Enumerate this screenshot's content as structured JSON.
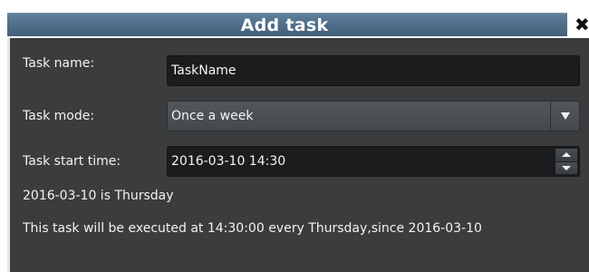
{
  "dialog": {
    "title": "Add task",
    "close_label": "✖"
  },
  "form": {
    "task_name": {
      "label": "Task name:",
      "value": "TaskName"
    },
    "task_mode": {
      "label": "Task mode:",
      "selected": "Once a week"
    },
    "task_start_time": {
      "label": "Task start time:",
      "value": "2016-03-10 14:30"
    }
  },
  "info": {
    "weekday_note": "2016-03-10 is Thursday",
    "schedule_summary": "This task will be executed at 14:30:00 every Thursday,since 2016-03-10"
  },
  "colors": {
    "title_bar": "#4e6d89",
    "dialog_background": "#3a3c3e",
    "field_background": "#1a1c1e",
    "text": "#f2f2f2"
  },
  "icons": {
    "close": "close-icon",
    "dropdown": "chevron-down-icon",
    "spin_up": "spin-up-icon",
    "spin_down": "spin-down-icon"
  }
}
